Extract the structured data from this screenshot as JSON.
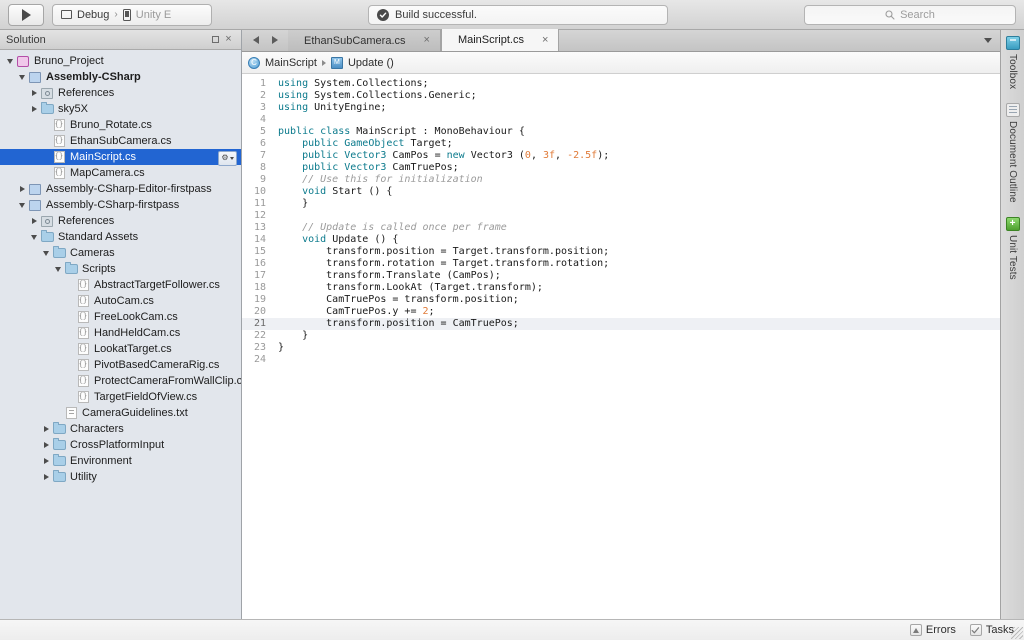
{
  "toolbar": {
    "run_button": "run-play",
    "configuration": "Debug",
    "device": "Unity E",
    "separator": "›",
    "build_status": "Build successful.",
    "search_placeholder": "Search"
  },
  "solution_pad": {
    "title": "Solution",
    "minimize_label": "□",
    "close_label": "×",
    "selected_row_gear": "⚙",
    "items": [
      {
        "label": "Bruno_Project",
        "depth": 0,
        "icon": "solution-icon",
        "twisty": "open",
        "bold": false,
        "selected": false
      },
      {
        "label": "Assembly-CSharp",
        "depth": 1,
        "icon": "project-icon",
        "twisty": "open",
        "bold": true,
        "selected": false
      },
      {
        "label": "References",
        "depth": 2,
        "icon": "references-icon",
        "twisty": "closed",
        "bold": false,
        "selected": false
      },
      {
        "label": "sky5X",
        "depth": 2,
        "icon": "folder-icon",
        "twisty": "closed",
        "bold": false,
        "selected": false
      },
      {
        "label": "Bruno_Rotate.cs",
        "depth": 3,
        "icon": "csharp-file-icon",
        "twisty": "none",
        "bold": false,
        "selected": false
      },
      {
        "label": "EthanSubCamera.cs",
        "depth": 3,
        "icon": "csharp-file-icon",
        "twisty": "none",
        "bold": false,
        "selected": false
      },
      {
        "label": "MainScript.cs",
        "depth": 3,
        "icon": "csharp-file-icon",
        "twisty": "none",
        "bold": false,
        "selected": true
      },
      {
        "label": "MapCamera.cs",
        "depth": 3,
        "icon": "csharp-file-icon",
        "twisty": "none",
        "bold": false,
        "selected": false
      },
      {
        "label": "Assembly-CSharp-Editor-firstpass",
        "depth": 1,
        "icon": "project-icon",
        "twisty": "closed",
        "bold": false,
        "selected": false
      },
      {
        "label": "Assembly-CSharp-firstpass",
        "depth": 1,
        "icon": "project-icon",
        "twisty": "open",
        "bold": false,
        "selected": false
      },
      {
        "label": "References",
        "depth": 2,
        "icon": "references-icon",
        "twisty": "closed",
        "bold": false,
        "selected": false
      },
      {
        "label": "Standard Assets",
        "depth": 2,
        "icon": "folder-icon",
        "twisty": "open",
        "bold": false,
        "selected": false
      },
      {
        "label": "Cameras",
        "depth": 3,
        "icon": "folder-icon",
        "twisty": "open",
        "bold": false,
        "selected": false
      },
      {
        "label": "Scripts",
        "depth": 4,
        "icon": "folder-icon",
        "twisty": "open",
        "bold": false,
        "selected": false
      },
      {
        "label": "AbstractTargetFollower.cs",
        "depth": 5,
        "icon": "csharp-file-icon",
        "twisty": "none",
        "bold": false,
        "selected": false
      },
      {
        "label": "AutoCam.cs",
        "depth": 5,
        "icon": "csharp-file-icon",
        "twisty": "none",
        "bold": false,
        "selected": false
      },
      {
        "label": "FreeLookCam.cs",
        "depth": 5,
        "icon": "csharp-file-icon",
        "twisty": "none",
        "bold": false,
        "selected": false
      },
      {
        "label": "HandHeldCam.cs",
        "depth": 5,
        "icon": "csharp-file-icon",
        "twisty": "none",
        "bold": false,
        "selected": false
      },
      {
        "label": "LookatTarget.cs",
        "depth": 5,
        "icon": "csharp-file-icon",
        "twisty": "none",
        "bold": false,
        "selected": false
      },
      {
        "label": "PivotBasedCameraRig.cs",
        "depth": 5,
        "icon": "csharp-file-icon",
        "twisty": "none",
        "bold": false,
        "selected": false
      },
      {
        "label": "ProtectCameraFromWallClip.cs",
        "depth": 5,
        "icon": "csharp-file-icon",
        "twisty": "none",
        "bold": false,
        "selected": false
      },
      {
        "label": "TargetFieldOfView.cs",
        "depth": 5,
        "icon": "csharp-file-icon",
        "twisty": "none",
        "bold": false,
        "selected": false
      },
      {
        "label": "CameraGuidelines.txt",
        "depth": 4,
        "icon": "text-file-icon",
        "twisty": "none",
        "bold": false,
        "selected": false
      },
      {
        "label": "Characters",
        "depth": 3,
        "icon": "folder-icon",
        "twisty": "closed",
        "bold": false,
        "selected": false
      },
      {
        "label": "CrossPlatformInput",
        "depth": 3,
        "icon": "folder-icon",
        "twisty": "closed",
        "bold": false,
        "selected": false
      },
      {
        "label": "Environment",
        "depth": 3,
        "icon": "folder-icon",
        "twisty": "closed",
        "bold": false,
        "selected": false
      },
      {
        "label": "Utility",
        "depth": 3,
        "icon": "folder-icon",
        "twisty": "closed",
        "bold": false,
        "selected": false
      }
    ]
  },
  "editor": {
    "tabs": [
      {
        "label": "EthanSubCamera.cs",
        "active": false,
        "close": "×"
      },
      {
        "label": "MainScript.cs",
        "active": true,
        "close": "×"
      }
    ],
    "breadcrumb": {
      "class": "MainScript",
      "member": "Update ()",
      "class_icon_glyph": "C",
      "member_icon_glyph": "M"
    },
    "current_line": 21,
    "lines": [
      {
        "n": 1,
        "tokens": [
          {
            "t": "using",
            "c": "kw"
          },
          {
            "t": " System.Collections;",
            "c": ""
          }
        ]
      },
      {
        "n": 2,
        "tokens": [
          {
            "t": "using",
            "c": "kw"
          },
          {
            "t": " System.Collections.Generic;",
            "c": ""
          }
        ]
      },
      {
        "n": 3,
        "tokens": [
          {
            "t": "using",
            "c": "kw"
          },
          {
            "t": " UnityEngine;",
            "c": ""
          }
        ]
      },
      {
        "n": 4,
        "tokens": [
          {
            "t": "",
            "c": ""
          }
        ]
      },
      {
        "n": 5,
        "tokens": [
          {
            "t": "public",
            "c": "kw"
          },
          {
            "t": " ",
            "c": ""
          },
          {
            "t": "class",
            "c": "kw"
          },
          {
            "t": " MainScript : MonoBehaviour {",
            "c": ""
          }
        ]
      },
      {
        "n": 6,
        "tokens": [
          {
            "t": "    ",
            "c": ""
          },
          {
            "t": "public",
            "c": "kw"
          },
          {
            "t": " ",
            "c": ""
          },
          {
            "t": "GameObject",
            "c": "kw"
          },
          {
            "t": " Target;",
            "c": ""
          }
        ]
      },
      {
        "n": 7,
        "tokens": [
          {
            "t": "    ",
            "c": ""
          },
          {
            "t": "public",
            "c": "kw"
          },
          {
            "t": " ",
            "c": ""
          },
          {
            "t": "Vector3",
            "c": "kw"
          },
          {
            "t": " CamPos = ",
            "c": ""
          },
          {
            "t": "new",
            "c": "kw"
          },
          {
            "t": " Vector3 (",
            "c": ""
          },
          {
            "t": "0",
            "c": "num"
          },
          {
            "t": ", ",
            "c": ""
          },
          {
            "t": "3f",
            "c": "num"
          },
          {
            "t": ", ",
            "c": ""
          },
          {
            "t": "-2.5f",
            "c": "num"
          },
          {
            "t": ");",
            "c": ""
          }
        ]
      },
      {
        "n": 8,
        "tokens": [
          {
            "t": "    ",
            "c": ""
          },
          {
            "t": "public",
            "c": "kw"
          },
          {
            "t": " ",
            "c": ""
          },
          {
            "t": "Vector3",
            "c": "kw"
          },
          {
            "t": " CamTruePos;",
            "c": ""
          }
        ]
      },
      {
        "n": 9,
        "tokens": [
          {
            "t": "    // Use this for initialization",
            "c": "cmt"
          }
        ]
      },
      {
        "n": 10,
        "tokens": [
          {
            "t": "    ",
            "c": ""
          },
          {
            "t": "void",
            "c": "kw"
          },
          {
            "t": " Start () {",
            "c": ""
          }
        ]
      },
      {
        "n": 11,
        "tokens": [
          {
            "t": "    }",
            "c": ""
          }
        ]
      },
      {
        "n": 12,
        "tokens": [
          {
            "t": "",
            "c": ""
          }
        ]
      },
      {
        "n": 13,
        "tokens": [
          {
            "t": "    // Update is called once per frame",
            "c": "cmt"
          }
        ]
      },
      {
        "n": 14,
        "tokens": [
          {
            "t": "    ",
            "c": ""
          },
          {
            "t": "void",
            "c": "kw"
          },
          {
            "t": " Update () {",
            "c": ""
          }
        ]
      },
      {
        "n": 15,
        "tokens": [
          {
            "t": "        transform.position = Target.transform.position;",
            "c": ""
          }
        ]
      },
      {
        "n": 16,
        "tokens": [
          {
            "t": "        transform.rotation = Target.transform.rotation;",
            "c": ""
          }
        ]
      },
      {
        "n": 17,
        "tokens": [
          {
            "t": "        transform.Translate (CamPos);",
            "c": ""
          }
        ]
      },
      {
        "n": 18,
        "tokens": [
          {
            "t": "        transform.LookAt (Target.transform);",
            "c": ""
          }
        ]
      },
      {
        "n": 19,
        "tokens": [
          {
            "t": "        CamTruePos = transform.position;",
            "c": ""
          }
        ]
      },
      {
        "n": 20,
        "tokens": [
          {
            "t": "        CamTruePos.y += ",
            "c": ""
          },
          {
            "t": "2",
            "c": "num"
          },
          {
            "t": ";",
            "c": ""
          }
        ]
      },
      {
        "n": 21,
        "tokens": [
          {
            "t": "        transform.position = CamTruePos;",
            "c": ""
          }
        ]
      },
      {
        "n": 22,
        "tokens": [
          {
            "t": "    }",
            "c": ""
          }
        ]
      },
      {
        "n": 23,
        "tokens": [
          {
            "t": "}",
            "c": ""
          }
        ]
      },
      {
        "n": 24,
        "tokens": [
          {
            "t": "",
            "c": ""
          }
        ]
      }
    ]
  },
  "right_pads": [
    {
      "label": "Toolbox",
      "icon": "toolbox-icon"
    },
    {
      "label": "Document Outline",
      "icon": "document-outline-icon"
    },
    {
      "label": "Unit Tests",
      "icon": "unit-tests-icon"
    }
  ],
  "statusbar": {
    "errors_label": "Errors",
    "tasks_label": "Tasks",
    "tasks_check": "✓"
  },
  "colors": {
    "accent_selection": "#2265d2",
    "sidebar_bg": "#e2e6ec",
    "keyword": "#0b7a8c",
    "comment": "#9b9b9b",
    "number": "#e07b39",
    "current_line": "#eef0f4"
  }
}
